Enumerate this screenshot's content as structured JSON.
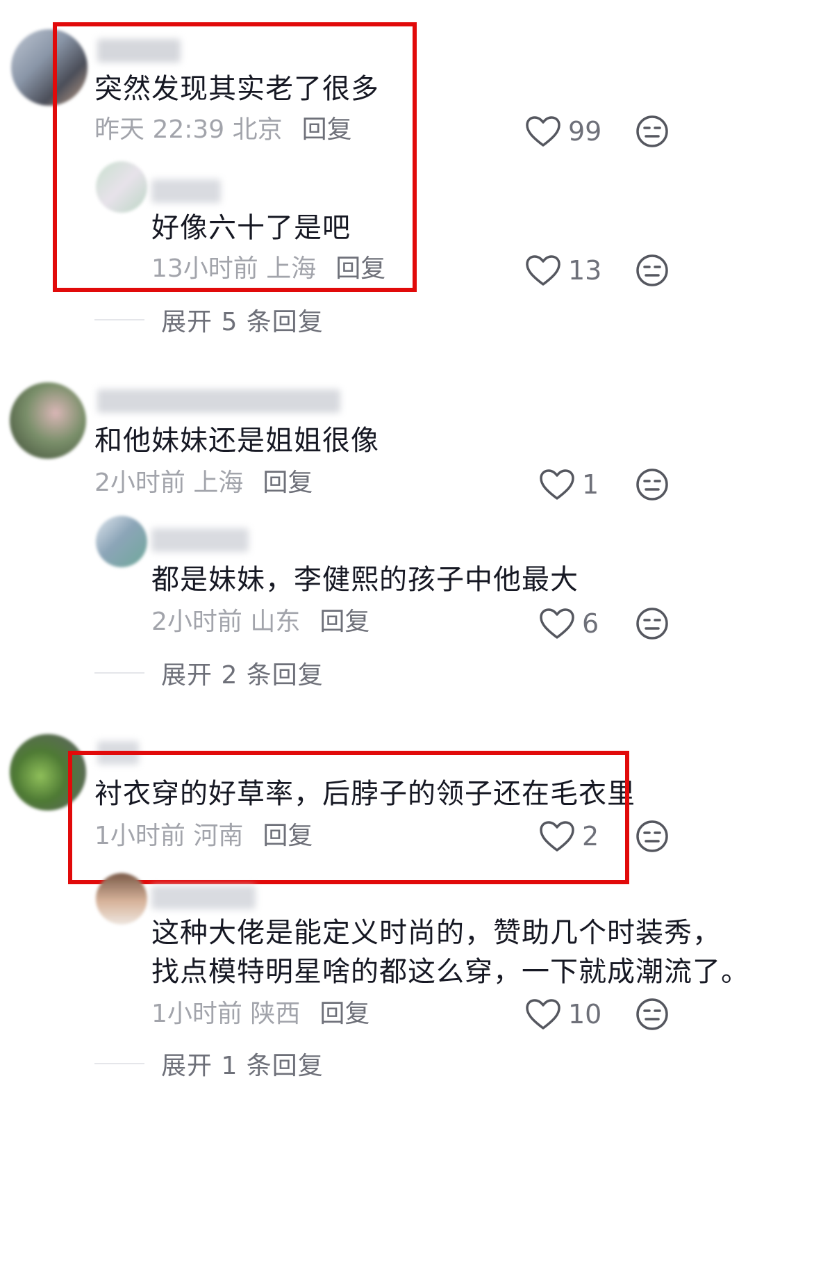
{
  "colors": {
    "highlight": "#e10a0a",
    "text": "#161823",
    "meta": "#a2a4ab",
    "action": "#6e7079"
  },
  "comments": [
    {
      "text": "突然发现其实老了很多",
      "time": "昨天 22:39 北京",
      "reply_label": "回复",
      "likes": "99",
      "reply": {
        "text": "好像六十了是吧",
        "time": "13小时前 上海",
        "reply_label": "回复",
        "likes": "13"
      },
      "expand_label": "展开 5 条回复"
    },
    {
      "text": "和他妹妹还是姐姐很像",
      "time": "2小时前 上海",
      "reply_label": "回复",
      "likes": "1",
      "reply": {
        "text": "都是妹妹，李健熙的孩子中他最大",
        "time": "2小时前 山东",
        "reply_label": "回复",
        "likes": "6"
      },
      "expand_label": "展开 2 条回复"
    },
    {
      "text": "衬衣穿的好草率，后脖子的领子还在毛衣里",
      "time": "1小时前 河南",
      "reply_label": "回复",
      "likes": "2",
      "reply": {
        "text_line1": "这种大佬是能定义时尚的，赞助几个时装秀，",
        "text_line2": "找点模特明星啥的都这么穿，一下就成潮流了。",
        "time": "1小时前 陕西",
        "reply_label": "回复",
        "likes": "10"
      },
      "expand_label": "展开 1 条回复"
    }
  ]
}
